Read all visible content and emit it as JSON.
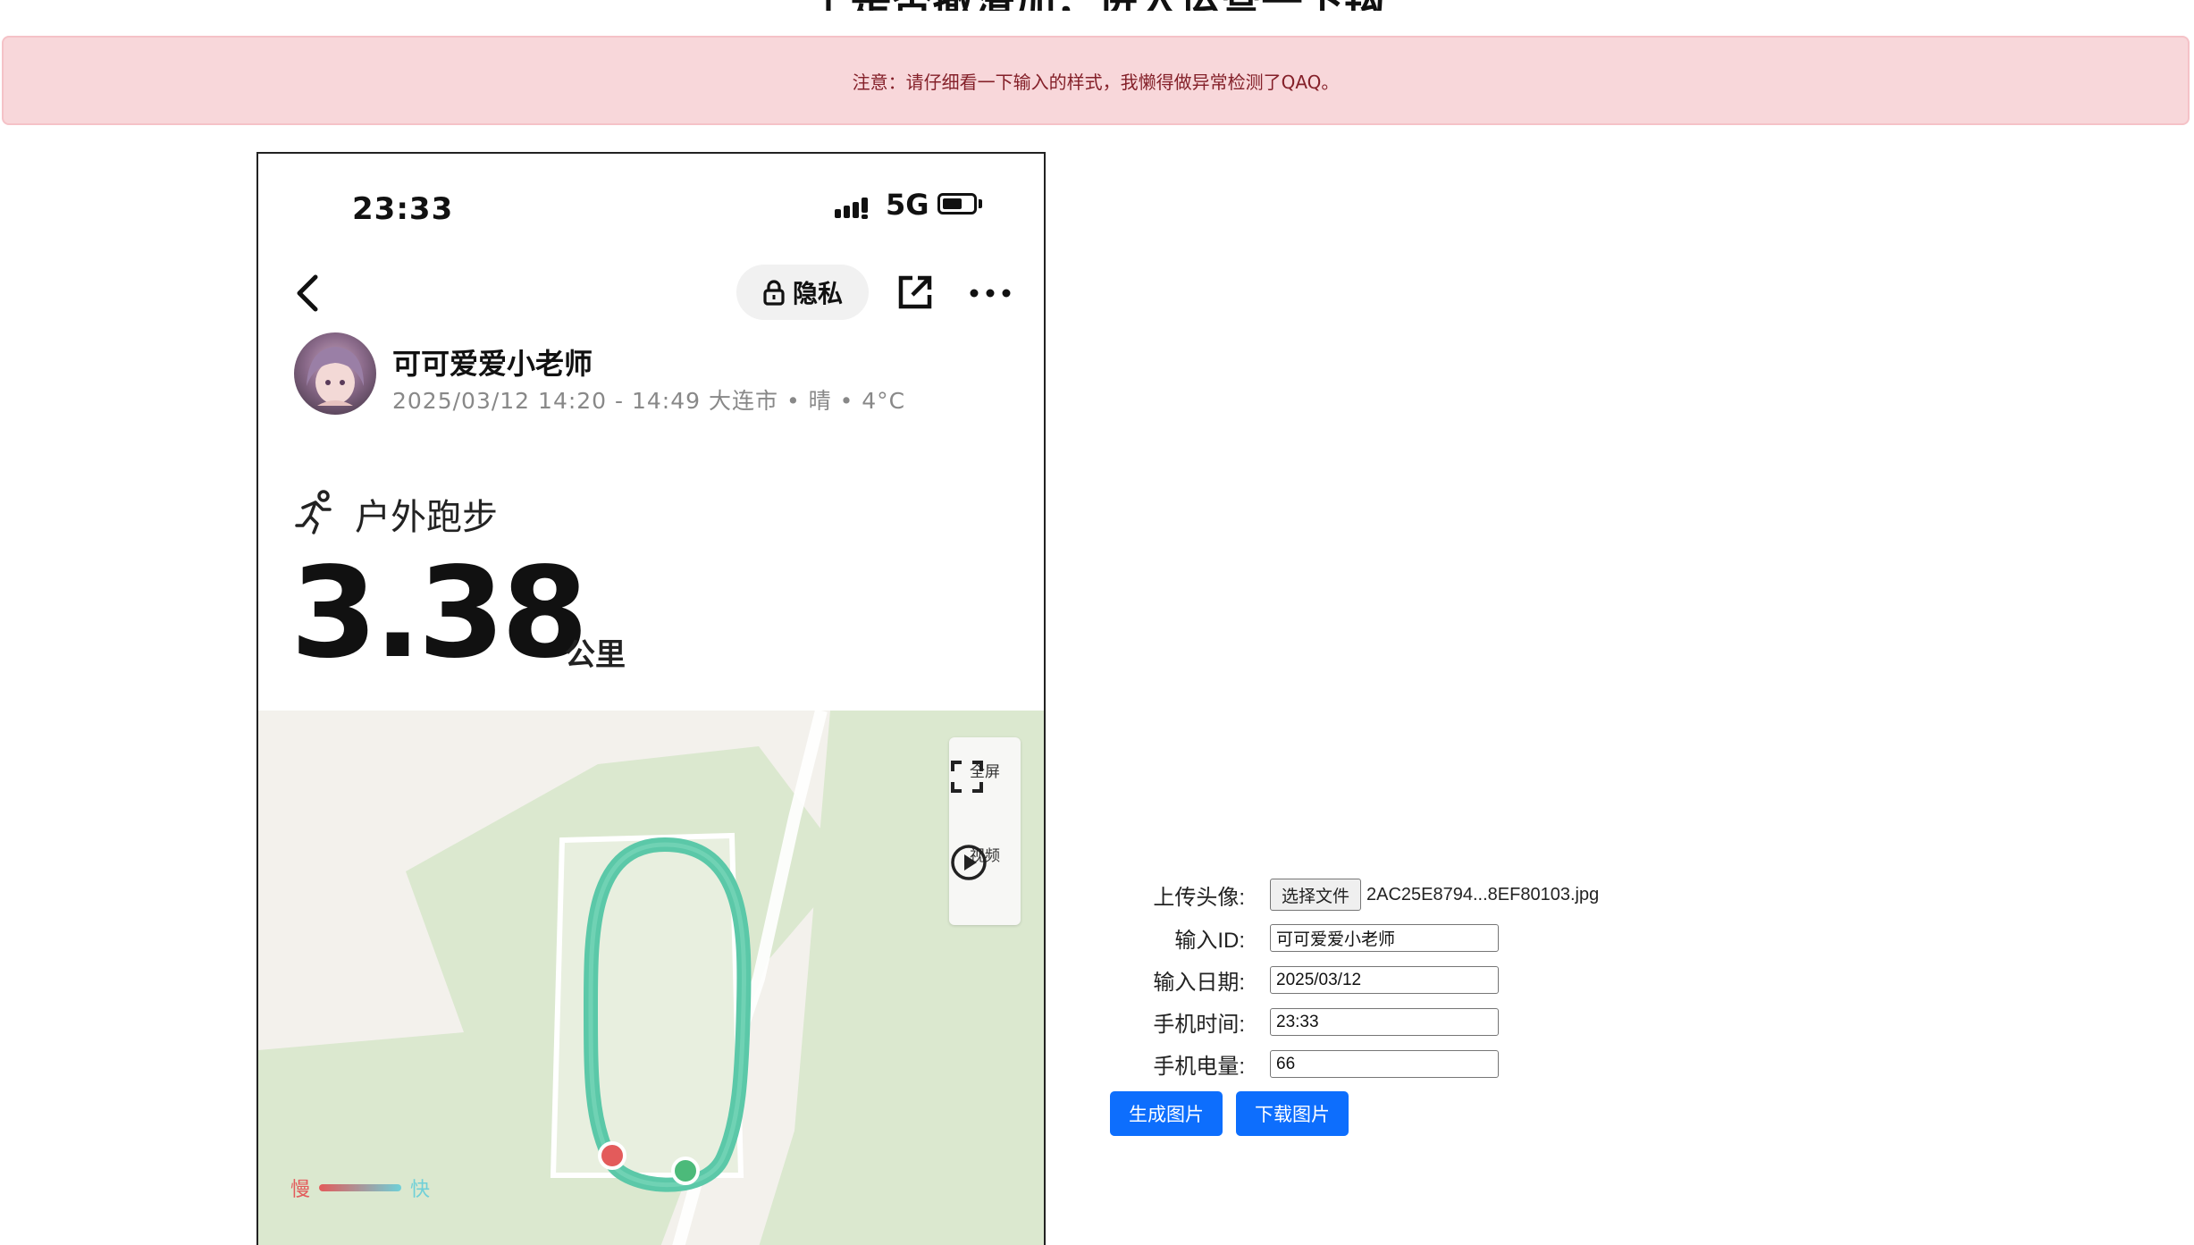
{
  "page": {
    "partial_title": "上是否撤滑加，进入运营一下钩"
  },
  "alert": {
    "text": "注意：请仔细看一下输入的样式，我懒得做异常检测了QAQ。"
  },
  "phone": {
    "status": {
      "time": "23:33",
      "network": "5G",
      "battery_percent": 66
    },
    "header": {
      "privacy_label": "隐私"
    },
    "user": {
      "name": "可可爱爱小老师",
      "meta": "2025/03/12 14:20 - 14:49  大连市 • 晴 • 4°C"
    },
    "workout": {
      "type": "户外跑步",
      "distance": "3.38",
      "unit": "公里"
    },
    "map": {
      "fullscreen_label": "全屏",
      "video_label": "视频",
      "legend_slow": "慢",
      "legend_fast": "快",
      "colors": {
        "track": "#5bc8a8",
        "start": "#4cba7a",
        "end": "#e35b5b",
        "green": "#dbe8cf"
      }
    }
  },
  "form": {
    "avatar_label": "上传头像:",
    "choose_file": "选择文件",
    "file_name": "2AC25E8794...8EF80103.jpg",
    "id_label": "输入ID:",
    "id_value": "可可爱爱小老师",
    "date_label": "输入日期:",
    "date_value": "2025/03/12",
    "time_label": "手机时间:",
    "time_value": "23:33",
    "battery_label": "手机电量:",
    "battery_value": "66",
    "generate_button": "生成图片",
    "download_button": "下载图片"
  },
  "colors": {
    "accent": "#0d6efd",
    "alert_bg": "#f8d7da",
    "alert_text": "#842029"
  }
}
